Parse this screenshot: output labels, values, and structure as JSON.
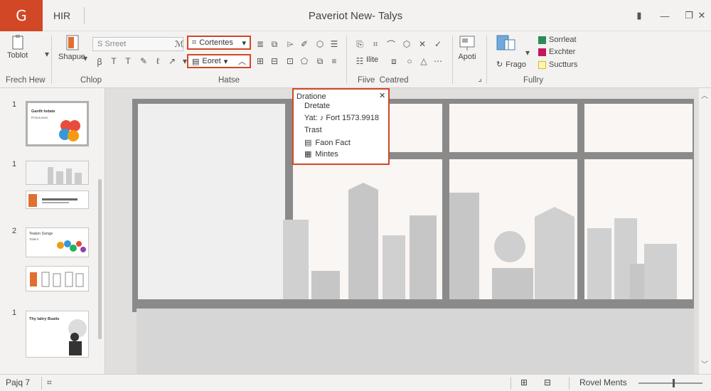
{
  "app": {
    "logo_letter": "G",
    "title": "Paveriot New- Talys",
    "tab_label": "HIR"
  },
  "window_controls": {
    "pin": "▮",
    "minimize": "—",
    "restore": "❐",
    "close": "✕"
  },
  "ribbon": {
    "groups": [
      "Frech Hew",
      "Chlop",
      "Hatse",
      "Fiive  Ceatred",
      "Fullry"
    ],
    "toblot_label": "Toblot",
    "shapes_label": "Shapue",
    "search_placeholder": "S Srreet",
    "dropdown1": "Cortentes",
    "dropdown2": "Eoret",
    "title_btn": "Ilite",
    "apoti_label": "Apoti",
    "frago_label": "Frago",
    "layers": [
      {
        "label": "Sorrleat",
        "color": "#2e8b57"
      },
      {
        "label": "Exchter",
        "color": "#c2185b"
      },
      {
        "label": "Suctturs",
        "color": "#d4c020"
      }
    ]
  },
  "thumbnails": [
    {
      "num": "1",
      "title": "Ganfit Indate",
      "subtitle": "Protorumes"
    },
    {
      "num": "1",
      "title": "",
      "subtitle": ""
    },
    {
      "num": "",
      "title": "",
      "subtitle": ""
    },
    {
      "num": "2",
      "title": "Tealsn Songe",
      "subtitle": "Tailent"
    },
    {
      "num": "",
      "title": "",
      "subtitle": ""
    },
    {
      "num": "1",
      "title": "Thy laitry Bsaits",
      "subtitle": ""
    }
  ],
  "popup": {
    "title": "Dratione",
    "close": "✕",
    "rows": [
      "Dretate",
      "Yat:  ♪ Fort 1573.9918",
      "Trast",
      "Faon Fact",
      "Mintes"
    ]
  },
  "statusbar": {
    "page": "Pajq 7",
    "view_mode": "Rovel Ments",
    "zoom_fraction": 0.55
  },
  "colors": {
    "accent": "#d24726",
    "window_frame": "#8a8a8a",
    "pane_bg": "#faf6f4",
    "building": "#c6c6c6"
  }
}
